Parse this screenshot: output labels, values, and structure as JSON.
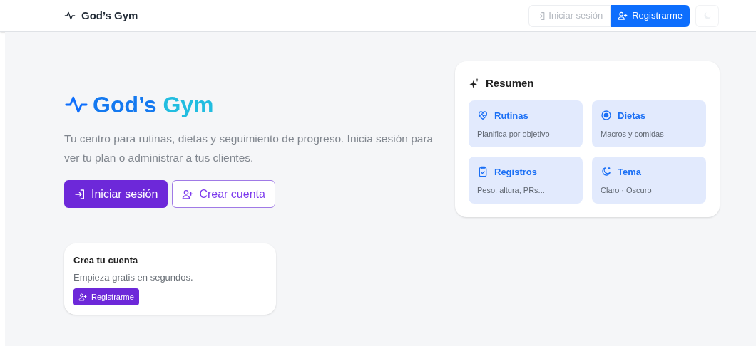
{
  "navbar": {
    "brand": "God’s Gym",
    "login": "Iniciar sesión",
    "register": "Registrarme"
  },
  "hero": {
    "title_first": "God’s",
    "title_second": "Gym",
    "description": "Tu centro para rutinas, dietas y seguimiento de progreso. Inicia sesión para ver tu plan o administrar a tus clientes.",
    "primary_button": "Iniciar sesión",
    "secondary_button": "Crear cuenta"
  },
  "signup_card": {
    "title": "Crea tu cuenta",
    "text": "Empieza gratis en segundos.",
    "button": "Registrarme"
  },
  "summary": {
    "title": "Resumen",
    "features": [
      {
        "kind": "heart",
        "title": "Rutinas",
        "text": "Planifica por objetivo"
      },
      {
        "kind": "target",
        "title": "Dietas",
        "text": "Macros y comidas"
      },
      {
        "kind": "clipboard",
        "title": "Registros",
        "text": "Peso, altura, PRs..."
      },
      {
        "kind": "moon",
        "title": "Tema",
        "text": "Claro · Oscuro"
      }
    ]
  }
}
